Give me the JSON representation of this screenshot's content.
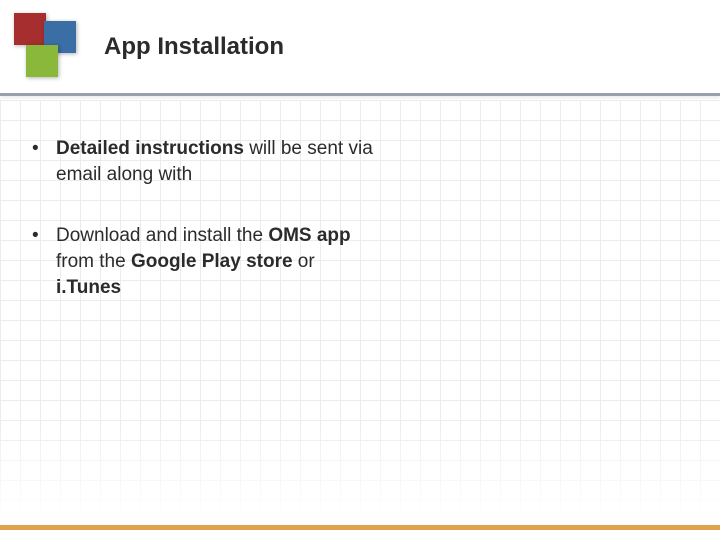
{
  "header": {
    "title": "App Installation"
  },
  "bullets": [
    {
      "runs": [
        {
          "text": "Detailed instructions",
          "bold": true
        },
        {
          "text": " will be sent via email along with",
          "bold": false
        }
      ]
    },
    {
      "runs": [
        {
          "text": "Download and install the ",
          "bold": false
        },
        {
          "text": "OMS app",
          "bold": true
        },
        {
          "text": " from the ",
          "bold": false
        },
        {
          "text": "Google Play store",
          "bold": true
        },
        {
          "text": " or ",
          "bold": false
        },
        {
          "text": "i.Tunes",
          "bold": true
        }
      ]
    }
  ],
  "theme": {
    "logo_colors": {
      "red": "#a72e2e",
      "blue": "#3a6ea5",
      "green": "#8ab83a"
    },
    "accent_bar": "#e0a24a"
  }
}
